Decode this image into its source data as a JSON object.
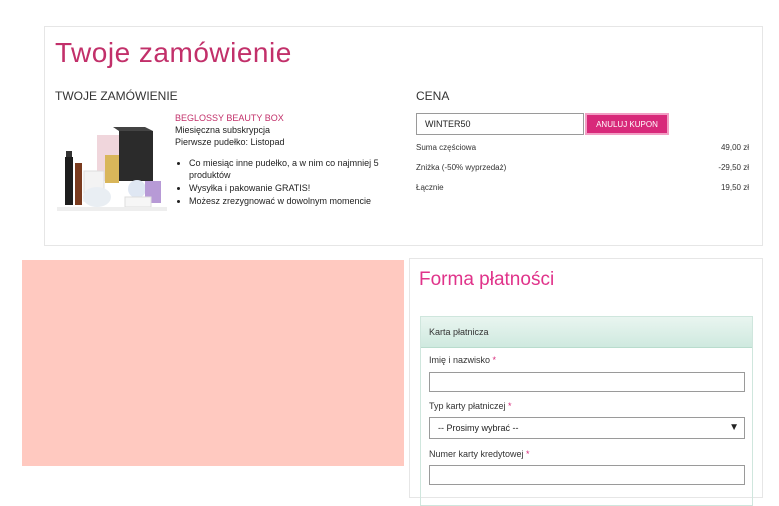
{
  "order": {
    "title": "Twoje zamówienie",
    "left_header": "Twoje zamówienie",
    "right_header": "Cena",
    "product": {
      "name": "Beglossy Beauty Box",
      "subscription": "Miesięczna subskrypcja",
      "first_box": "Pierwsze pudełko: Listopad",
      "features": [
        "Co miesiąc inne pudełko, a w nim co najmniej 5 produktów",
        "Wysyłka i pakowanie GRATIS!",
        "Możesz zrezygnować w dowolnym momencie"
      ]
    },
    "coupon": {
      "value": "WINTER50",
      "button_label": "Anuluj kupon"
    },
    "prices": {
      "subtotal_label": "Suma częściowa",
      "subtotal_value": "49,00 zł",
      "discount_label": "Zniżka (-50% wyprzedaż)",
      "discount_value": "-29,50 zł",
      "total_label": "Łącznie",
      "total_value": "19,50 zł"
    }
  },
  "payment": {
    "title": "Forma płatności",
    "card_header": "Karta płatnicza",
    "fields": {
      "name_label": "Imię i nazwisko",
      "card_type_label": "Typ karty płatniczej",
      "card_type_selected": "-- Prosimy wybrać --",
      "card_number_label": "Numer karty kredytowej",
      "required_mark": "*"
    }
  },
  "colors": {
    "accent": "#d8297a",
    "title_pink": "#c2306a",
    "placeholder_block": "#ffc9c0",
    "card_header_bg": "#d6ede4"
  },
  "icons": {
    "select_arrow": "caret-down-icon"
  }
}
